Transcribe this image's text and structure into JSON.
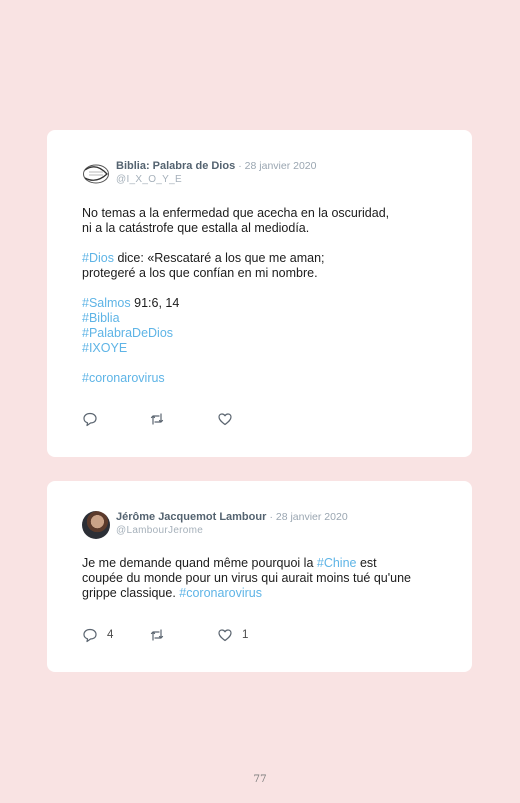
{
  "tweets": [
    {
      "author": "Biblia: Palabra de Dios",
      "date": "· 28 janvier 2020",
      "handle": "@I_X_O_Y_E",
      "avatar_icon": "ichthys-fish-icon",
      "lines": [
        [
          {
            "text": "No temas a la enfermedad que acecha en la oscuridad,"
          }
        ],
        [
          {
            "text": "ni a la catástrofe que estalla al mediodía."
          }
        ],
        [],
        [
          {
            "text": "#Dios",
            "tag": true
          },
          {
            "text": " dice: «Rescataré a los que me aman;"
          }
        ],
        [
          {
            "text": "protegeré a los que confían en mi nombre."
          }
        ],
        [],
        [
          {
            "text": "#Salmos",
            "tag": true
          },
          {
            "text": " 91:6, 14"
          }
        ],
        [
          {
            "text": "#Biblia",
            "tag": true
          }
        ],
        [
          {
            "text": "#PalabraDeDios",
            "tag": true
          }
        ],
        [
          {
            "text": "#IXOYE",
            "tag": true
          }
        ],
        [],
        [
          {
            "text": "#coronarovirus",
            "tag": true
          }
        ]
      ],
      "reply_count": "",
      "retweet_count": "",
      "like_count": ""
    },
    {
      "author": "Jérôme Jacquemot Lambour",
      "date": "· 28 janvier 2020",
      "handle": "@LambourJerome",
      "avatar_icon": "profile-photo",
      "lines": [
        [
          {
            "text": "Je me demande quand même pourquoi la "
          },
          {
            "text": "#Chine",
            "tag": true
          },
          {
            "text": " est"
          }
        ],
        [
          {
            "text": "coupée du monde pour un virus qui aurait moins tué qu'une"
          }
        ],
        [
          {
            "text": "grippe classique. "
          },
          {
            "text": "#coronarovirus",
            "tag": true
          }
        ]
      ],
      "reply_count": "4",
      "retweet_count": "",
      "like_count": "1"
    }
  ],
  "page_number": "77",
  "colors": {
    "background": "#f9e3e3",
    "hashtag": "#5eb4e6",
    "card": "#ffffff"
  }
}
